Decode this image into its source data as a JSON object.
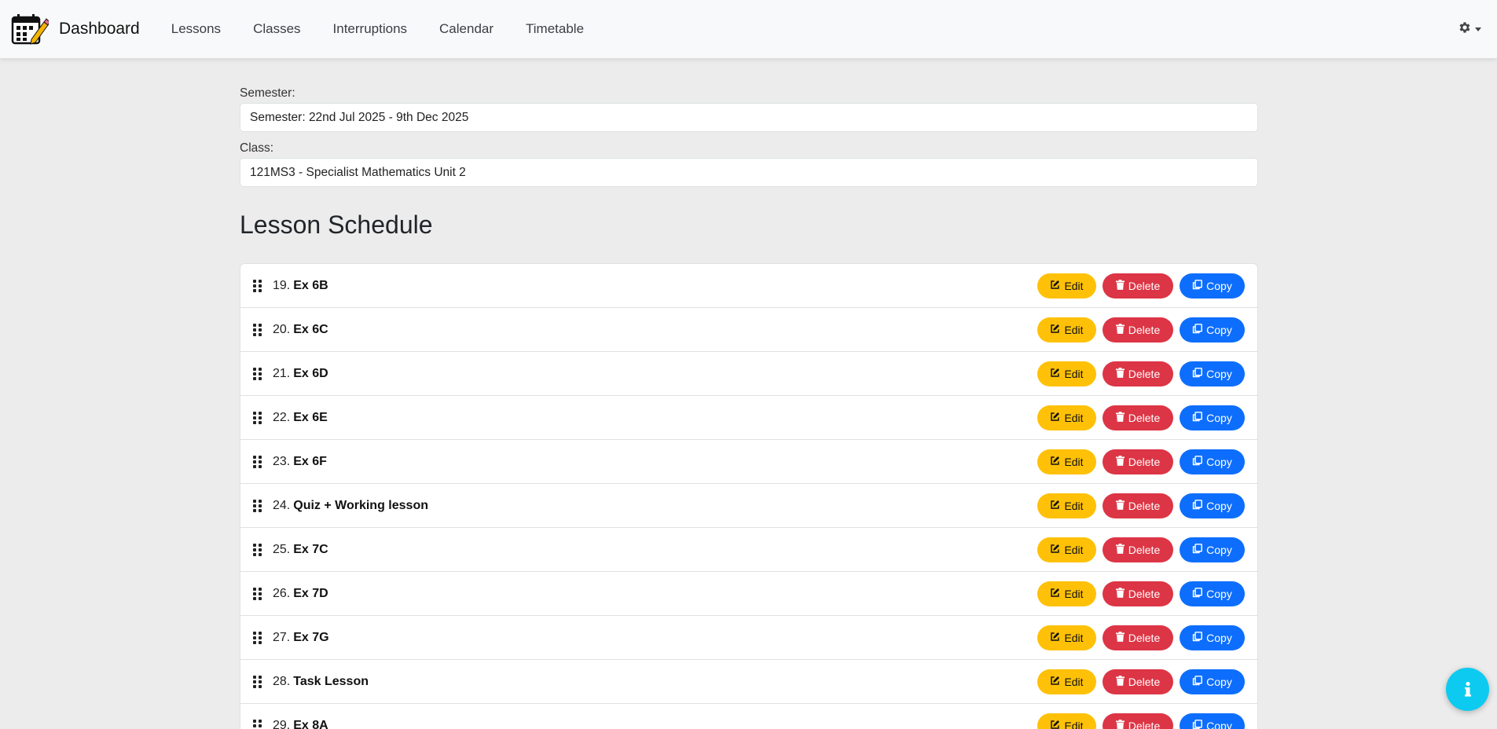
{
  "nav": {
    "brand": "Dashboard",
    "links": [
      "Lessons",
      "Classes",
      "Interruptions",
      "Calendar",
      "Timetable"
    ]
  },
  "filters": {
    "semester_label": "Semester:",
    "semester_value": "Semester: 22nd Jul 2025 - 9th Dec 2025",
    "class_label": "Class:",
    "class_value": "121MS3 - Specialist Mathematics Unit 2"
  },
  "schedule": {
    "title": "Lesson Schedule",
    "lessons": [
      {
        "num": "19.",
        "name": "Ex 6B"
      },
      {
        "num": "20.",
        "name": "Ex 6C"
      },
      {
        "num": "21.",
        "name": "Ex 6D"
      },
      {
        "num": "22.",
        "name": "Ex 6E"
      },
      {
        "num": "23.",
        "name": "Ex 6F"
      },
      {
        "num": "24.",
        "name": "Quiz + Working lesson"
      },
      {
        "num": "25.",
        "name": "Ex 7C"
      },
      {
        "num": "26.",
        "name": "Ex 7D"
      },
      {
        "num": "27.",
        "name": "Ex 7G"
      },
      {
        "num": "28.",
        "name": "Task Lesson"
      },
      {
        "num": "29.",
        "name": "Ex 8A"
      }
    ],
    "edit_label": "Edit",
    "delete_label": "Delete",
    "copy_label": "Copy"
  },
  "colors": {
    "edit": "#ffc107",
    "delete": "#dc3545",
    "copy": "#0d6efd",
    "info": "#0dcaf0"
  },
  "icons": {
    "logo": "calendar-pencil-icon",
    "settings": "gear-icon",
    "drag": "drag-handle-icon",
    "edit": "pencil-square-icon",
    "delete": "trash-icon",
    "copy": "copy-icon",
    "info": "info-icon"
  },
  "info_symbol": "i"
}
